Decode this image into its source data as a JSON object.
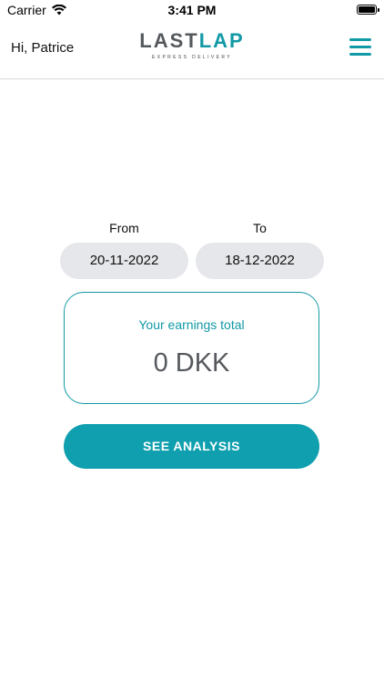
{
  "status_bar": {
    "carrier": "Carrier",
    "time": "3:41 PM"
  },
  "header": {
    "greeting": "Hi, Patrice",
    "logo_part1": "LAST",
    "logo_part2": "LAP",
    "logo_tagline": "EXPRESS DELIVERY"
  },
  "dates": {
    "from_label": "From",
    "from_value": "20-11-2022",
    "to_label": "To",
    "to_value": "18-12-2022"
  },
  "earnings": {
    "label": "Your earnings total",
    "value": "0 DKK"
  },
  "actions": {
    "see_analysis_label": "SEE ANALYSIS"
  },
  "colors": {
    "accent": "#1199a5",
    "text_dark": "#55585c",
    "pill_bg": "#e6e7ea"
  }
}
